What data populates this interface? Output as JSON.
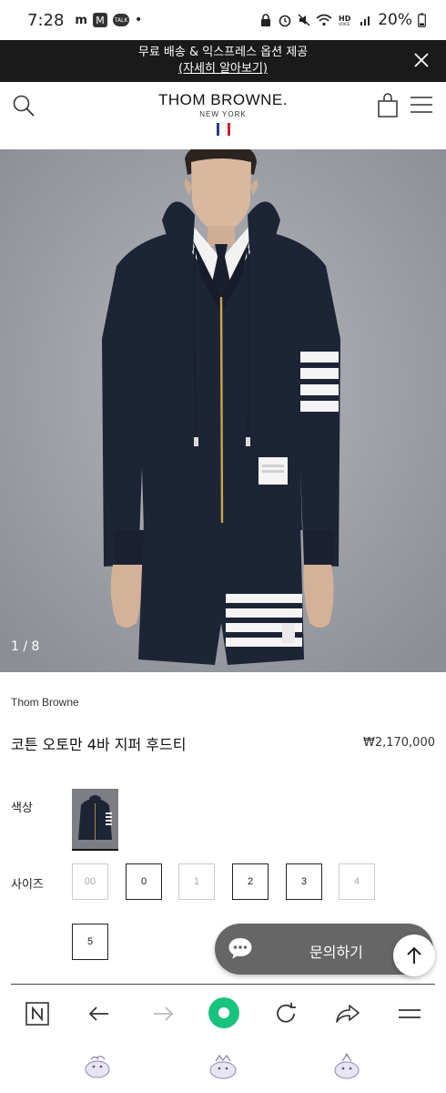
{
  "status_bar": {
    "time": "7:28",
    "battery": "20%",
    "left_icons": [
      "m-icon",
      "m-box-icon",
      "talk-icon"
    ],
    "right_icons": [
      "lock-icon",
      "alarm-icon",
      "mute-icon",
      "wifi-icon",
      "hd-voice-icon",
      "signal-icon",
      "battery-icon"
    ]
  },
  "promo": {
    "line1": "무료 배송 & 익스프레스 옵션 제공",
    "link": "(자세히 알아보기)"
  },
  "header": {
    "brand_name": "THOM BROWNE.",
    "brand_sub": "NEW YORK",
    "flag_colors": [
      "#2b3a8f",
      "#ffffff",
      "#c8202f"
    ]
  },
  "hero": {
    "counter": "1 / 8"
  },
  "product": {
    "brand": "Thom Browne",
    "name": "코튼 오토만 4바 지퍼 후드티",
    "price": "₩2,170,000"
  },
  "options": {
    "color_label": "색상",
    "size_label": "사이즈",
    "sizes": [
      {
        "label": "00",
        "available": false
      },
      {
        "label": "0",
        "available": true
      },
      {
        "label": "1",
        "available": false
      },
      {
        "label": "2",
        "available": true
      },
      {
        "label": "3",
        "available": true
      },
      {
        "label": "4",
        "available": false
      },
      {
        "label": "5",
        "available": true
      }
    ]
  },
  "chat": {
    "label": "문의하기"
  },
  "colors": {
    "navy": "#1d2436",
    "promo_bg": "#1a1a1a",
    "chat_bg": "#666666",
    "accent_green": "#19c37d"
  }
}
